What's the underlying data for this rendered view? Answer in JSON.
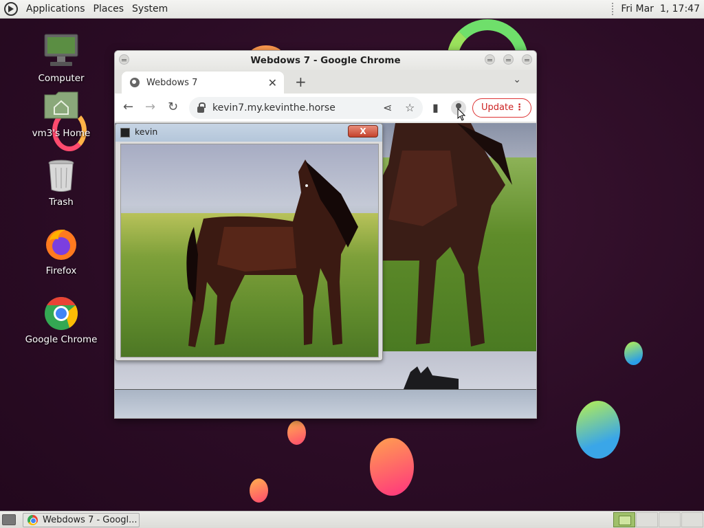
{
  "top_panel": {
    "menus": [
      "Applications",
      "Places",
      "System"
    ],
    "clock": "Fri Mar  1, 17:47"
  },
  "desktop_icons": [
    {
      "label": "Computer",
      "icon": "computer-icon"
    },
    {
      "label": "vm3's Home",
      "icon": "home-folder-icon"
    },
    {
      "label": "Trash",
      "icon": "trash-icon"
    },
    {
      "label": "Firefox",
      "icon": "firefox-icon"
    },
    {
      "label": "Google Chrome",
      "icon": "chrome-icon"
    }
  ],
  "chrome_window": {
    "title": "Webdows 7 - Google Chrome",
    "tab_title": "Webdows 7",
    "new_tab_symbol": "+",
    "url": "kevin7.my.kevinthe.horse",
    "update_label": "Update"
  },
  "kevin_window": {
    "title": "kevin",
    "close_symbol": "X"
  },
  "taskbar": {
    "task_label": "Webdows 7 - Googl..."
  },
  "colors": {
    "accent_update": "#d33333",
    "desktop_bg": "#2b0c25"
  }
}
